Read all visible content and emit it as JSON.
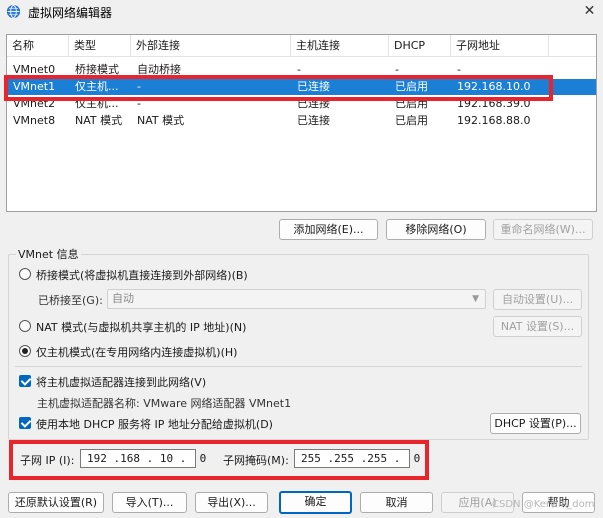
{
  "window": {
    "title": "虚拟网络编辑器",
    "close_glyph": "✕"
  },
  "network_list": {
    "columns": [
      "名称",
      "类型",
      "外部连接",
      "主机连接",
      "DHCP",
      "子网地址"
    ],
    "rows": [
      {
        "name": "VMnet0",
        "type": "桥接模式",
        "external": "自动桥接",
        "host": "-",
        "dhcp": "-",
        "subnet": "-"
      },
      {
        "name": "VMnet1",
        "type": "仅主机...",
        "external": "-",
        "host": "已连接",
        "dhcp": "已启用",
        "subnet": "192.168.10.0"
      },
      {
        "name": "VMnet2",
        "type": "仅主机...",
        "external": "-",
        "host": "已连接",
        "dhcp": "已启用",
        "subnet": "192.168.39.0"
      },
      {
        "name": "VMnet8",
        "type": "NAT 模式",
        "external": "NAT 模式",
        "host": "已连接",
        "dhcp": "已启用",
        "subnet": "192.168.88.0"
      }
    ],
    "selected_index": 1
  },
  "list_buttons": {
    "add": "添加网络(E)...",
    "remove": "移除网络(O)",
    "rename": "重命名网络(W)..."
  },
  "vmnet_info": {
    "group_title": "VMnet 信息",
    "bridged_label": "桥接模式(将虚拟机直接连接到外部网络)(B)",
    "bridged_to_label": "已桥接至(G):",
    "bridged_to_value": "自动",
    "auto_settings": "自动设置(U)...",
    "nat_label": "NAT 模式(与虚拟机共享主机的 IP 地址)(N)",
    "nat_settings": "NAT 设置(S)...",
    "hostonly_label": "仅主机模式(在专用网络内连接虚拟机)(H)",
    "connect_adapter_label": "将主机虚拟适配器连接到此网络(V)",
    "adapter_name_label": "主机虚拟适配器名称: VMware 网络适配器 VMnet1",
    "dhcp_label": "使用本地 DHCP 服务将 IP 地址分配给虚拟机(D)",
    "dhcp_settings": "DHCP 设置(P)...",
    "subnet_ip_label": "子网 IP (I):",
    "subnet_ip_value": "192 .168 . 10 .  0",
    "subnet_mask_label": "子网掩码(M):",
    "subnet_mask_value": "255 .255 .255 .  0"
  },
  "footer": {
    "restore": "还原默认设置(R)",
    "import": "导入(T)...",
    "export": "导出(X)...",
    "ok": "确定",
    "cancel": "取消",
    "apply": "应用(A)",
    "help": "帮助"
  },
  "watermark": "CSDN @Kerwin_dom",
  "colors": {
    "selection": "#1c7fd6",
    "highlight": "#e8242c",
    "accent": "#0067c0"
  }
}
